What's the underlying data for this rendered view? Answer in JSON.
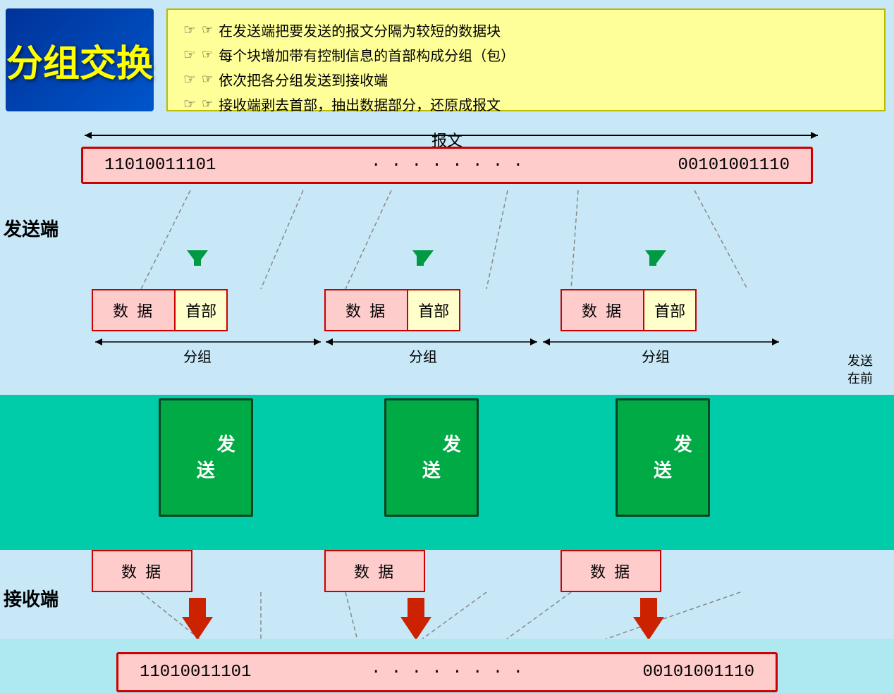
{
  "title": {
    "text": "分组交换"
  },
  "info": {
    "items": [
      "在发送端把要发送的报文分隔为较短的数据块",
      "每个块增加带有控制信息的首部构成分组（包）",
      "依次把各分组发送到接收端",
      "接收端剥去首部，抽出数据部分，还原成报文"
    ]
  },
  "baowen_label": "报文",
  "binary_left": "11010011101",
  "binary_dots": "· · · · · · · ·",
  "binary_right": "00101001110",
  "data_label": "数  据",
  "header_label": "首部",
  "fenzhu_label": "分组",
  "fasong_label": "发\n送",
  "fasongduan_label": "发送端",
  "jieshoudan_label": "接收端",
  "fasong_qian_label": "发送\n在前",
  "bottom_binary_left": "11010011101",
  "bottom_binary_dots": "· · · · · · · ·",
  "bottom_binary_right": "00101001110",
  "colors": {
    "background": "#c8e8f8",
    "teal": "#00ccaa",
    "pink_box": "#ffcccc",
    "yellow_box": "#ffffcc",
    "info_bg": "#ffff99",
    "title_bg": "#003399",
    "title_text": "#ffff00",
    "green_send": "#00aa44",
    "red": "#cc0000"
  }
}
